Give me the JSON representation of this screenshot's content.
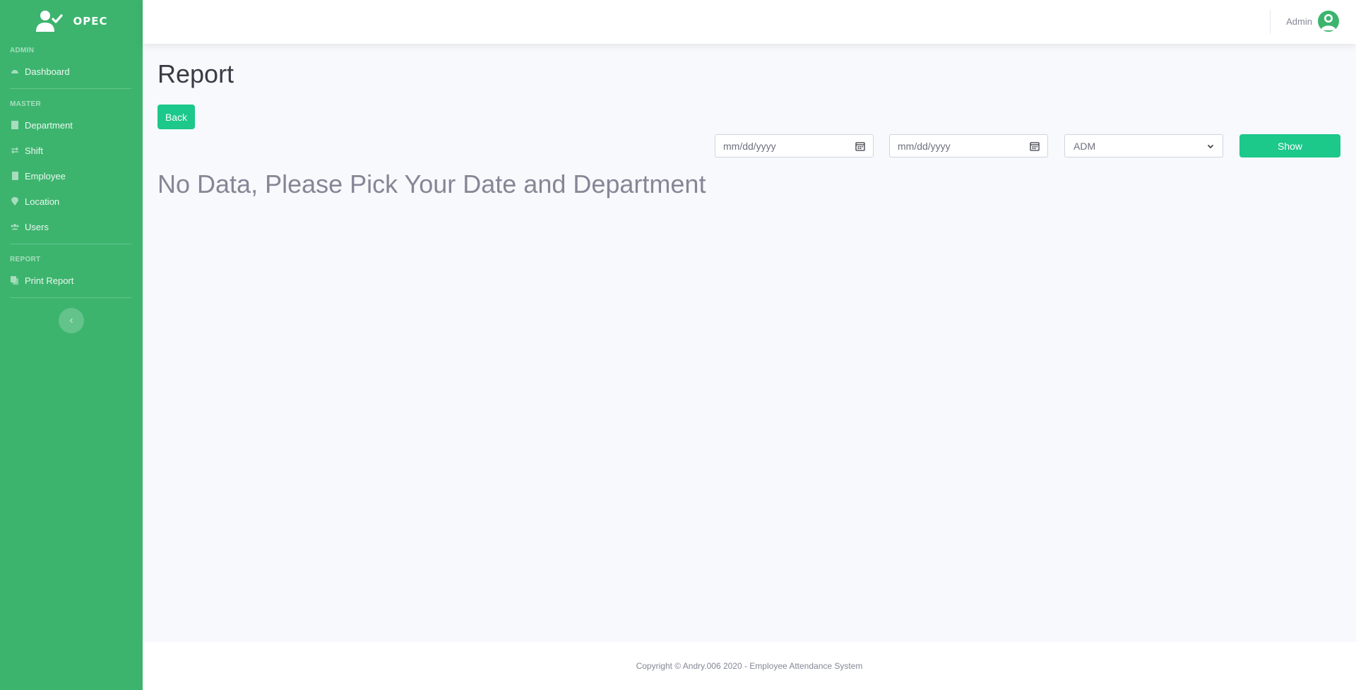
{
  "brand": {
    "name": "OPEC"
  },
  "sidebar": {
    "sections": [
      {
        "heading": "Admin",
        "items": [
          {
            "label": "Dashboard",
            "icon": "tachometer-icon"
          }
        ]
      },
      {
        "heading": "Master",
        "items": [
          {
            "label": "Department",
            "icon": "building-icon"
          },
          {
            "label": "Shift",
            "icon": "exchange-icon"
          },
          {
            "label": "Employee",
            "icon": "id-badge-icon"
          },
          {
            "label": "Location",
            "icon": "map-marker-icon"
          },
          {
            "label": "Users",
            "icon": "users-icon"
          }
        ]
      },
      {
        "heading": "Report",
        "items": [
          {
            "label": "Print Report",
            "icon": "copy-icon"
          }
        ]
      }
    ],
    "toggle_icon": "chevron-left-icon"
  },
  "topbar": {
    "user_name": "Admin"
  },
  "main": {
    "title": "Report",
    "back_label": "Back",
    "start_date_placeholder": "mm/dd/yyyy",
    "end_date_placeholder": "mm/dd/yyyy",
    "department_selected": "ADM",
    "show_label": "Show",
    "empty_message": "No Data, Please Pick Your Date and Department"
  },
  "footer": {
    "copyright": "Copyright © Andry.006 2020 - Employee Attendance System"
  },
  "colors": {
    "sidebar_bg": "#3cb46e",
    "accent_button": "#1cc88a",
    "page_bg": "#f8f9fc"
  }
}
